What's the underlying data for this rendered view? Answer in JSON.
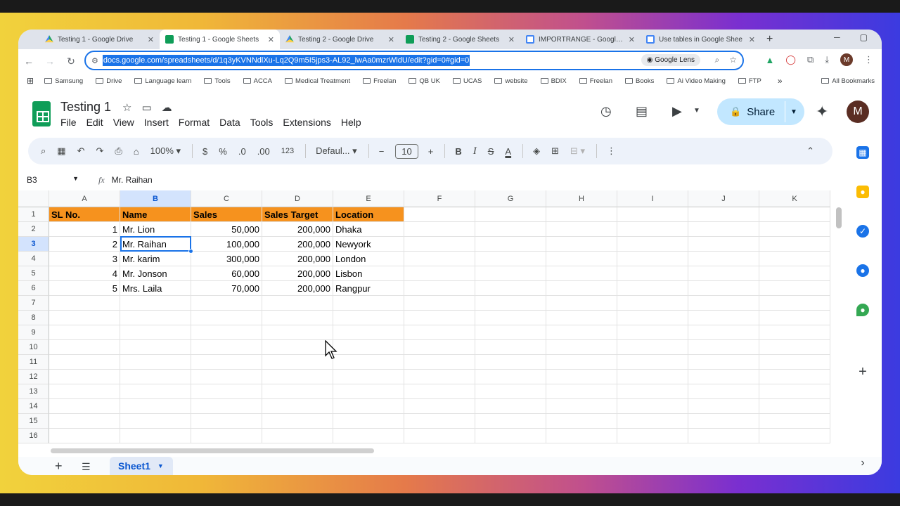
{
  "browser": {
    "tabs": [
      {
        "title": "Testing 1 - Google Drive",
        "icon": "drive-icon",
        "active": false
      },
      {
        "title": "Testing 1 - Google Sheets",
        "icon": "sheets-icon",
        "active": true
      },
      {
        "title": "Testing 2 - Google Drive",
        "icon": "drive-icon",
        "active": false
      },
      {
        "title": "Testing 2 - Google Sheets",
        "icon": "sheets-icon",
        "active": false
      },
      {
        "title": "IMPORTRANGE - Google Do",
        "icon": "google-icon",
        "active": false
      },
      {
        "title": "Use tables in Google Shee",
        "icon": "google-icon",
        "active": false
      }
    ],
    "new_tab": "+",
    "url": "docs.google.com/spreadsheets/d/1q3yKVNNdlXu-Lq2Q9m5I5jps3-AL92_lwAa0mzrWldU/edit?gid=0#gid=0",
    "lens_label": "Google Lens",
    "profile_initial": "M",
    "bookmarks": [
      "Samsung",
      "Drive",
      "Language learn",
      "Tools",
      "ACCA",
      "Medical Treatment",
      "Freelan",
      "QB UK",
      "UCAS",
      "website",
      "BDIX",
      "Freelan",
      "Books",
      "Ai Video Making",
      "FTP"
    ],
    "all_bookmarks": "All Bookmarks"
  },
  "sheets": {
    "doc_title": "Testing 1",
    "menu": [
      "File",
      "Edit",
      "View",
      "Insert",
      "Format",
      "Data",
      "Tools",
      "Extensions",
      "Help"
    ],
    "share_label": "Share",
    "avatar_initial": "M",
    "toolbar": {
      "zoom": "100%",
      "currency": "$",
      "percent": "%",
      "dec_decrease": ".0",
      "dec_increase": ".00",
      "number_format": "123",
      "font": "Defaul...",
      "font_size": "10",
      "bold": "B",
      "italic": "I",
      "strike": "S",
      "text_color": "A"
    },
    "name_box": "B3",
    "formula": "Mr. Raihan",
    "columns": [
      "A",
      "B",
      "C",
      "D",
      "E",
      "F",
      "G",
      "H",
      "I",
      "J",
      "K"
    ],
    "rows": [
      "1",
      "2",
      "3",
      "4",
      "5",
      "6",
      "7",
      "8",
      "9",
      "10",
      "11",
      "12",
      "13",
      "14",
      "15",
      "16"
    ],
    "table": {
      "headers": [
        "SL No.",
        "Name",
        "Sales",
        "Sales Target",
        "Location"
      ],
      "data": [
        [
          "1",
          "Mr. Lion",
          "50,000",
          "200,000",
          "Dhaka"
        ],
        [
          "2",
          "Mr. Raihan",
          "100,000",
          "200,000",
          "Newyork"
        ],
        [
          "3",
          "Mr. karim",
          "300,000",
          "200,000",
          "London"
        ],
        [
          "4",
          "Mr. Jonson",
          "60,000",
          "200,000",
          "Lisbon"
        ],
        [
          "5",
          "Mrs. Laila",
          "70,000",
          "200,000",
          "Rangpur"
        ]
      ]
    },
    "sheet_tab": "Sheet1",
    "header_fill": "#f6921e",
    "accent": "#1a73e8"
  }
}
